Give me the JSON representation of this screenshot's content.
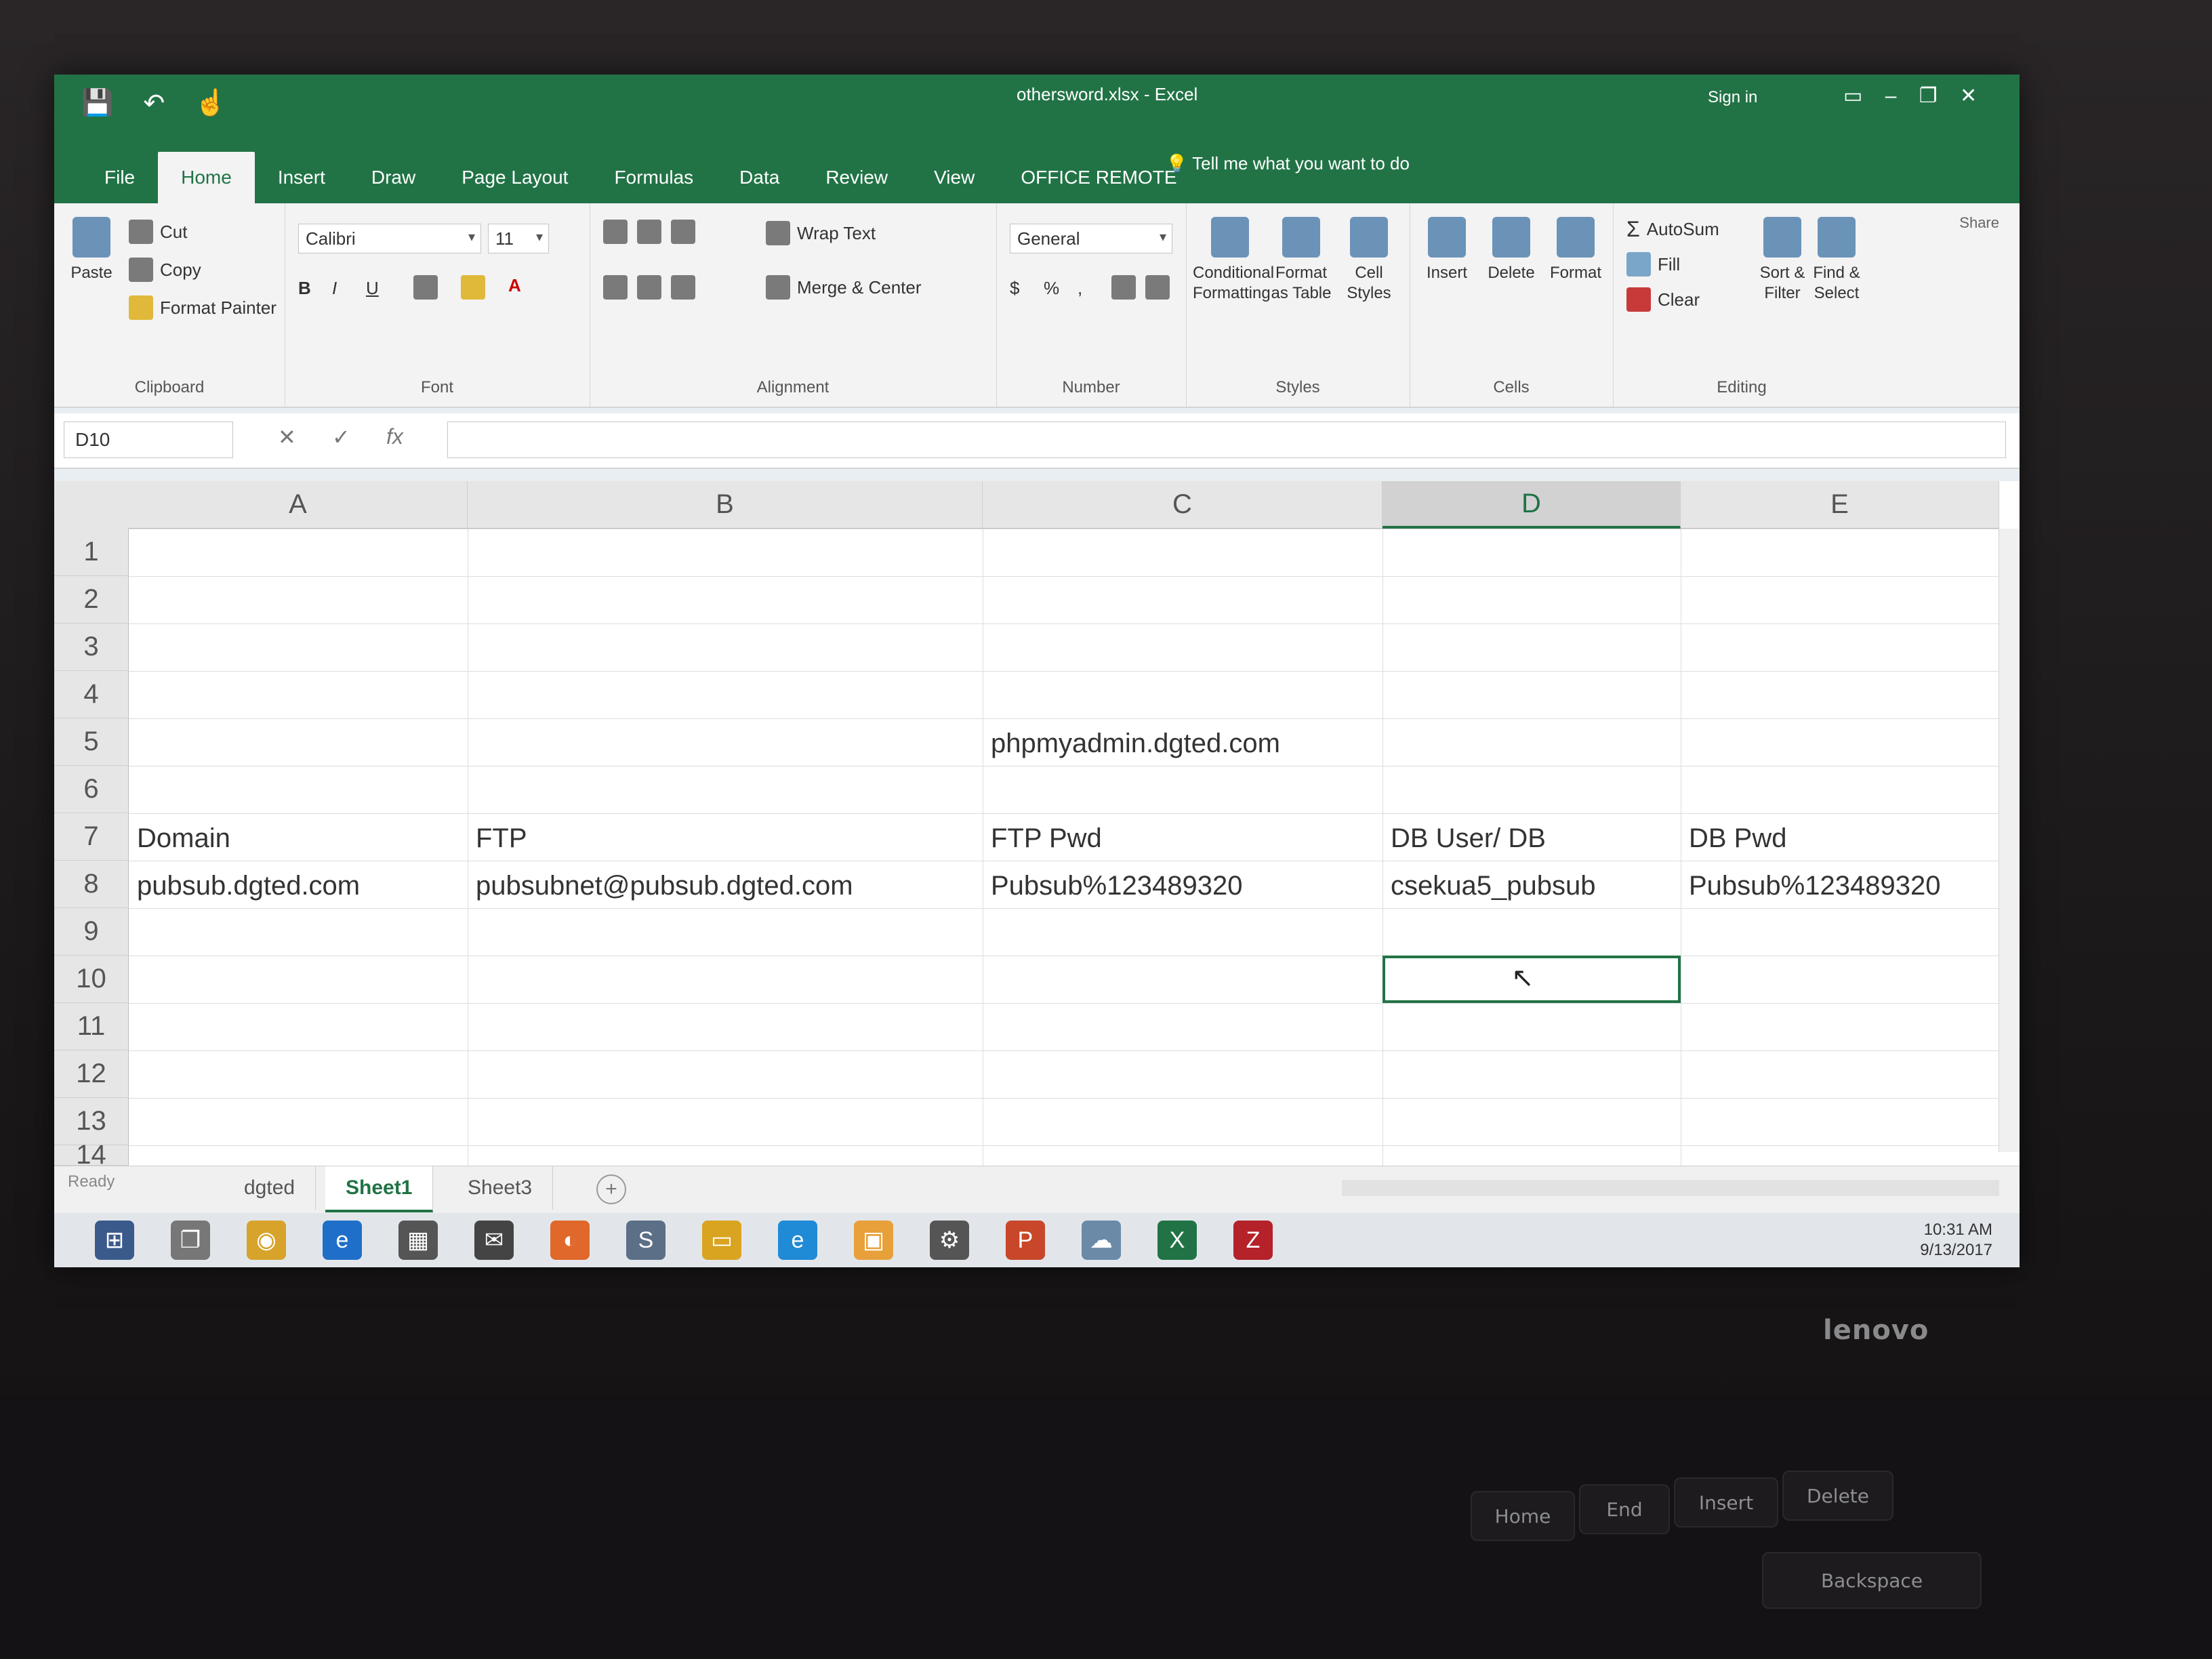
{
  "window": {
    "title": "othersword.xlsx - Excel",
    "sign_in": "Sign in",
    "share": "Share"
  },
  "tabs": [
    "File",
    "Home",
    "Insert",
    "Draw",
    "Page Layout",
    "Formulas",
    "Data",
    "Review",
    "View",
    "OFFICE REMOTE"
  ],
  "tell_me": "Tell me what you want to do",
  "ribbon": {
    "clipboard": {
      "paste": "Paste",
      "cut": "Cut",
      "copy": "Copy",
      "format_painter": "Format Painter",
      "label": "Clipboard"
    },
    "font": {
      "name": "Calibri",
      "size": "11",
      "label": "Font"
    },
    "alignment": {
      "wrap_text": "Wrap Text",
      "merge_center": "Merge & Center",
      "label": "Alignment"
    },
    "number": {
      "format": "General",
      "label": "Number"
    },
    "styles": {
      "conditional": "Conditional Formatting",
      "format_table": "Format as Table",
      "cell_styles": "Cell Styles",
      "label": "Styles"
    },
    "cells": {
      "insert": "Insert",
      "delete": "Delete",
      "format": "Format",
      "label": "Cells"
    },
    "editing": {
      "autosum": "AutoSum",
      "fill": "Fill",
      "clear": "Clear",
      "sort": "Sort & Filter",
      "find": "Find & Select",
      "label": "Editing"
    }
  },
  "formula_bar": {
    "name_box": "D10",
    "fx": "fx",
    "value": ""
  },
  "columns": [
    "A",
    "B",
    "C",
    "D",
    "E"
  ],
  "rows": [
    "1",
    "2",
    "3",
    "4",
    "5",
    "6",
    "7",
    "8",
    "9",
    "10",
    "11",
    "12",
    "13",
    "14"
  ],
  "cells": {
    "C5": "phpmyadmin.dgted.com",
    "A7": "Domain",
    "B7": "FTP",
    "C7": "FTP Pwd",
    "D7": "DB User/ DB",
    "E7": "DB Pwd",
    "A8": "pubsub.dgted.com",
    "B8": "pubsubnet@pubsub.dgted.com",
    "C8": "Pubsub%123489320",
    "D8": "csekua5_pubsub",
    "E8": "Pubsub%123489320"
  },
  "sheets": [
    "dgted",
    "Sheet1",
    "Sheet3"
  ],
  "status": "Ready",
  "clock": {
    "time": "10:31 AM",
    "date": "9/13/2017"
  },
  "laptop_brand": "lenovo",
  "keys": [
    "Home",
    "End",
    "Insert",
    "Delete",
    "Backspace"
  ]
}
